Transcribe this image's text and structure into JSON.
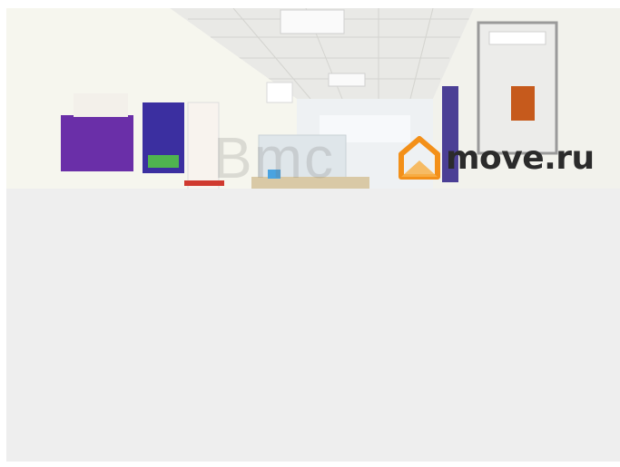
{
  "image": {
    "watermark_faint": "Bmc",
    "brand": {
      "name": "move.ru",
      "accent_color": "#f39019",
      "text_color": "#2b2b2b"
    },
    "background_color": "#eeeeee"
  }
}
